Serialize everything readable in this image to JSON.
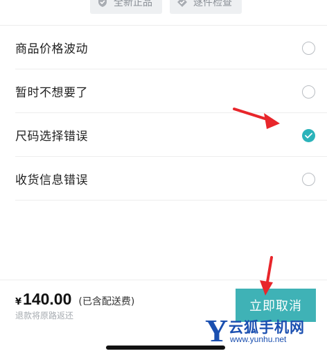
{
  "tags": [
    {
      "label": "全新正品",
      "icon": "shield-check-icon"
    },
    {
      "label": "逐件检查",
      "icon": "tag-check-icon"
    }
  ],
  "reasons": [
    {
      "label": "商品价格波动",
      "selected": false
    },
    {
      "label": "暂时不想要了",
      "selected": false
    },
    {
      "label": "尺码选择错误",
      "selected": true
    },
    {
      "label": "收货信息错误",
      "selected": false
    }
  ],
  "footer": {
    "currency": "¥",
    "price": "140.00",
    "fee_note": "(已含配送费)",
    "refund_note": "退款将原路返还",
    "cancel_label": "立即取消"
  },
  "watermark": {
    "letter": "Y",
    "name": "云狐手机网",
    "url": "www.yunhu.net"
  },
  "colors": {
    "accent": "#3fb2b6",
    "checked": "#2bb3ba",
    "annotation": "#e8262b",
    "watermark": "#1a4fb0"
  }
}
